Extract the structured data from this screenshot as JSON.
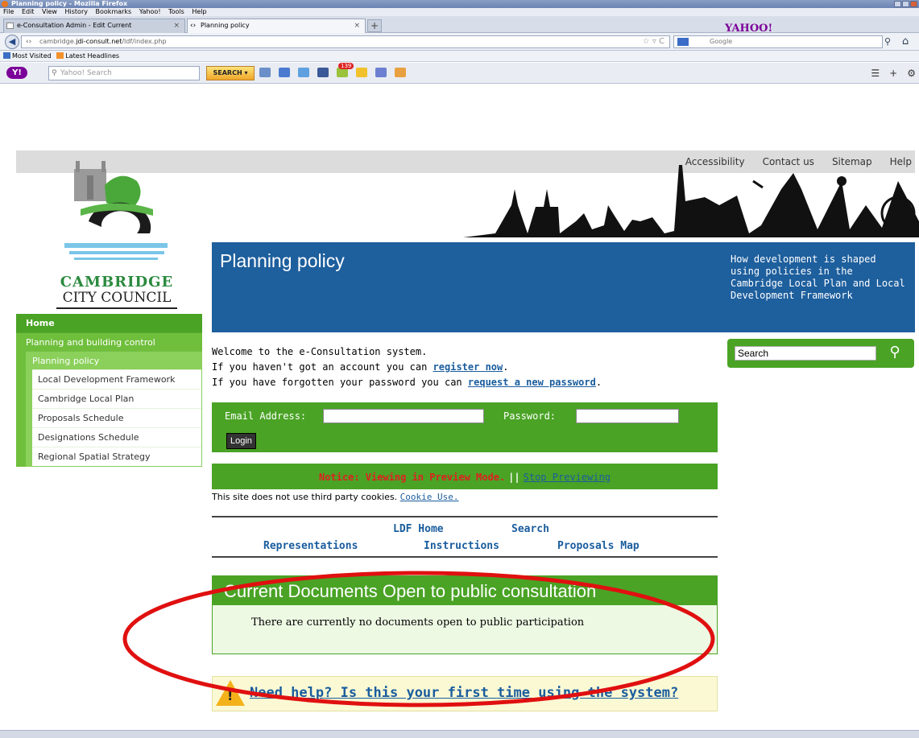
{
  "browser": {
    "window_title": "Planning policy - Mozilla Firefox",
    "menu": [
      "File",
      "Edit",
      "View",
      "History",
      "Bookmarks",
      "Yahoo!",
      "Tools",
      "Help"
    ],
    "tabs": [
      {
        "label": "e-Consultation Admin - Edit Current"
      },
      {
        "label": "Planning policy"
      }
    ],
    "new_tab": "+",
    "yahoo_brand": "YAHOO!",
    "url_prefix": "cambridge.",
    "url_domain": "jdi-consult.net",
    "url_path": "/ldf/index.php",
    "search_engine_placeholder": "Google",
    "bookmarks": [
      "Most Visited",
      "Latest Headlines"
    ],
    "yahoo_toolbar": {
      "search_placeholder": "Yahoo! Search",
      "search_button": "SEARCH",
      "badge": "139"
    }
  },
  "site": {
    "top_links": [
      "Accessibility",
      "Contact us",
      "Sitemap",
      "Help"
    ],
    "logo_line1": "CAMBRIDGE",
    "logo_line2": "CITY COUNCIL",
    "banner_title": "Planning policy",
    "banner_desc": "How development is shaped using policies in the Cambridge Local Plan and Local Development Framework",
    "sidebar": {
      "home": "Home",
      "level1": "Planning and building control",
      "level2": "Planning policy",
      "items": [
        "Local Development Framework",
        "Cambridge Local Plan",
        "Proposals Schedule",
        "Designations Schedule",
        "Regional Spatial Strategy"
      ]
    },
    "search_value": "Search",
    "welcome": {
      "line1": "Welcome to the e-Consultation system.",
      "line2_pre": "If you haven't got an account you can ",
      "line2_link": "register now",
      "line2_post": ".",
      "line3_pre": "If you have forgotten your password you can ",
      "line3_link": "request a new password",
      "line3_post": "."
    },
    "login": {
      "email_label": "Email Address:",
      "password_label": "Password:",
      "button": "Login"
    },
    "notice": {
      "text": "Notice: Viewing in Preview Mode.",
      "sep": "||",
      "link": "Stop Previewing"
    },
    "cookie": {
      "text": "This site does not use third party cookies. ",
      "link": "Cookie Use."
    },
    "nav": {
      "ldf_home": "LDF Home",
      "search": "Search",
      "representations": "Representations",
      "instructions": "Instructions",
      "proposals_map": "Proposals Map"
    },
    "docs": {
      "heading": "Current Documents Open to public consultation",
      "message": "There are currently no documents open to public participation"
    },
    "help_link": "Need help? Is this your first time using the system?"
  },
  "colors": {
    "green": "#4aa325",
    "blue": "#1e5f9d",
    "link": "#1a5d9e",
    "annotation": "#e01010"
  }
}
